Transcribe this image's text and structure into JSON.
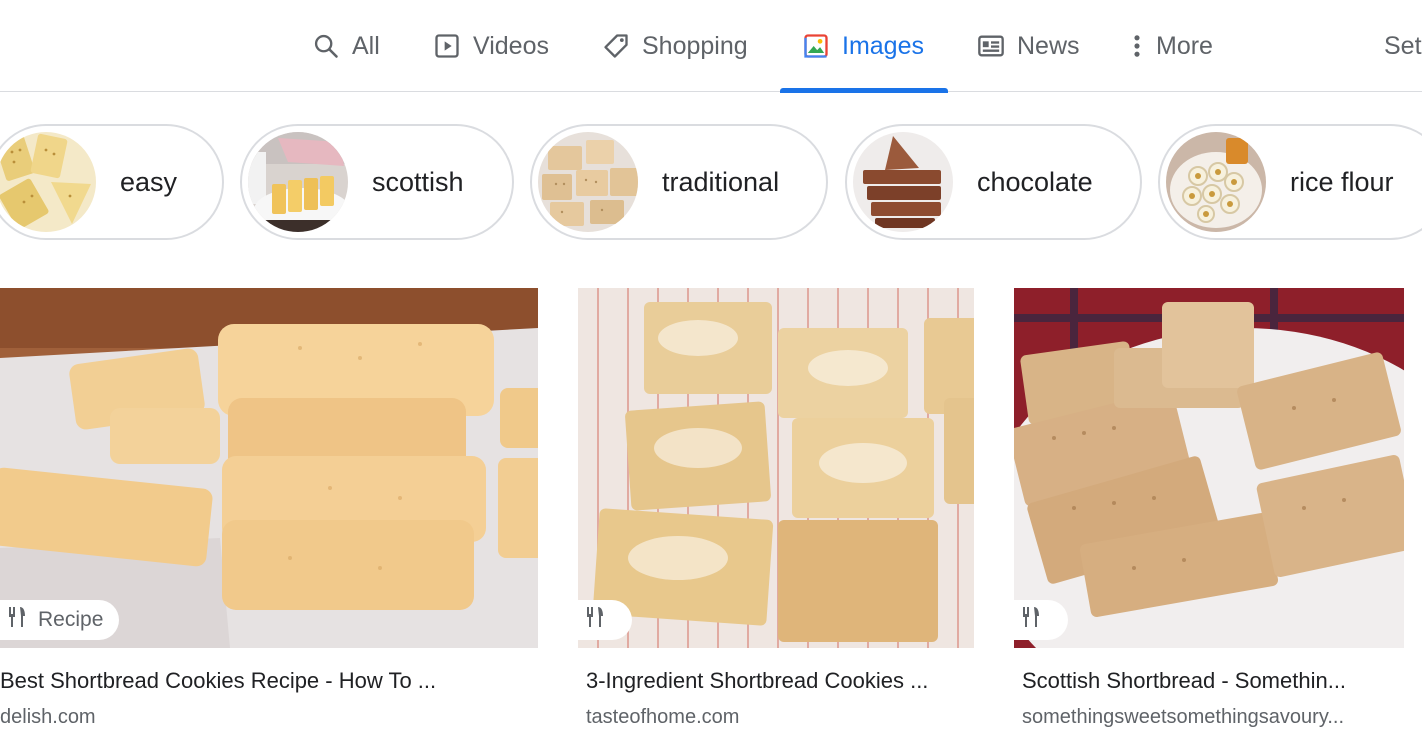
{
  "tabs": [
    {
      "label": "All",
      "icon": "search-icon"
    },
    {
      "label": "Videos",
      "icon": "video-icon"
    },
    {
      "label": "Shopping",
      "icon": "tag-icon"
    },
    {
      "label": "Images",
      "icon": "image-icon",
      "active": true
    },
    {
      "label": "News",
      "icon": "news-icon"
    },
    {
      "label": "More",
      "icon": "more-vert-icon"
    }
  ],
  "settings_label": "Set",
  "colors": {
    "accent": "#1a73e8",
    "text": "#202124",
    "muted": "#5f6368",
    "border": "#dadce0"
  },
  "chips": [
    {
      "label": "easy"
    },
    {
      "label": "scottish"
    },
    {
      "label": "traditional"
    },
    {
      "label": "chocolate"
    },
    {
      "label": "rice flour"
    }
  ],
  "results": [
    {
      "title": "Best Shortbread Cookies Recipe - How To ...",
      "source": "delish.com",
      "badge": "Recipe",
      "badge_icon": "utensils-icon"
    },
    {
      "title": "3-Ingredient Shortbread Cookies ...",
      "source": "tasteofhome.com",
      "badge": "",
      "badge_icon": "utensils-icon"
    },
    {
      "title": "Scottish Shortbread - Somethin...",
      "source": "somethingsweetsomethingsavoury...",
      "badge": "",
      "badge_icon": "utensils-icon"
    }
  ]
}
